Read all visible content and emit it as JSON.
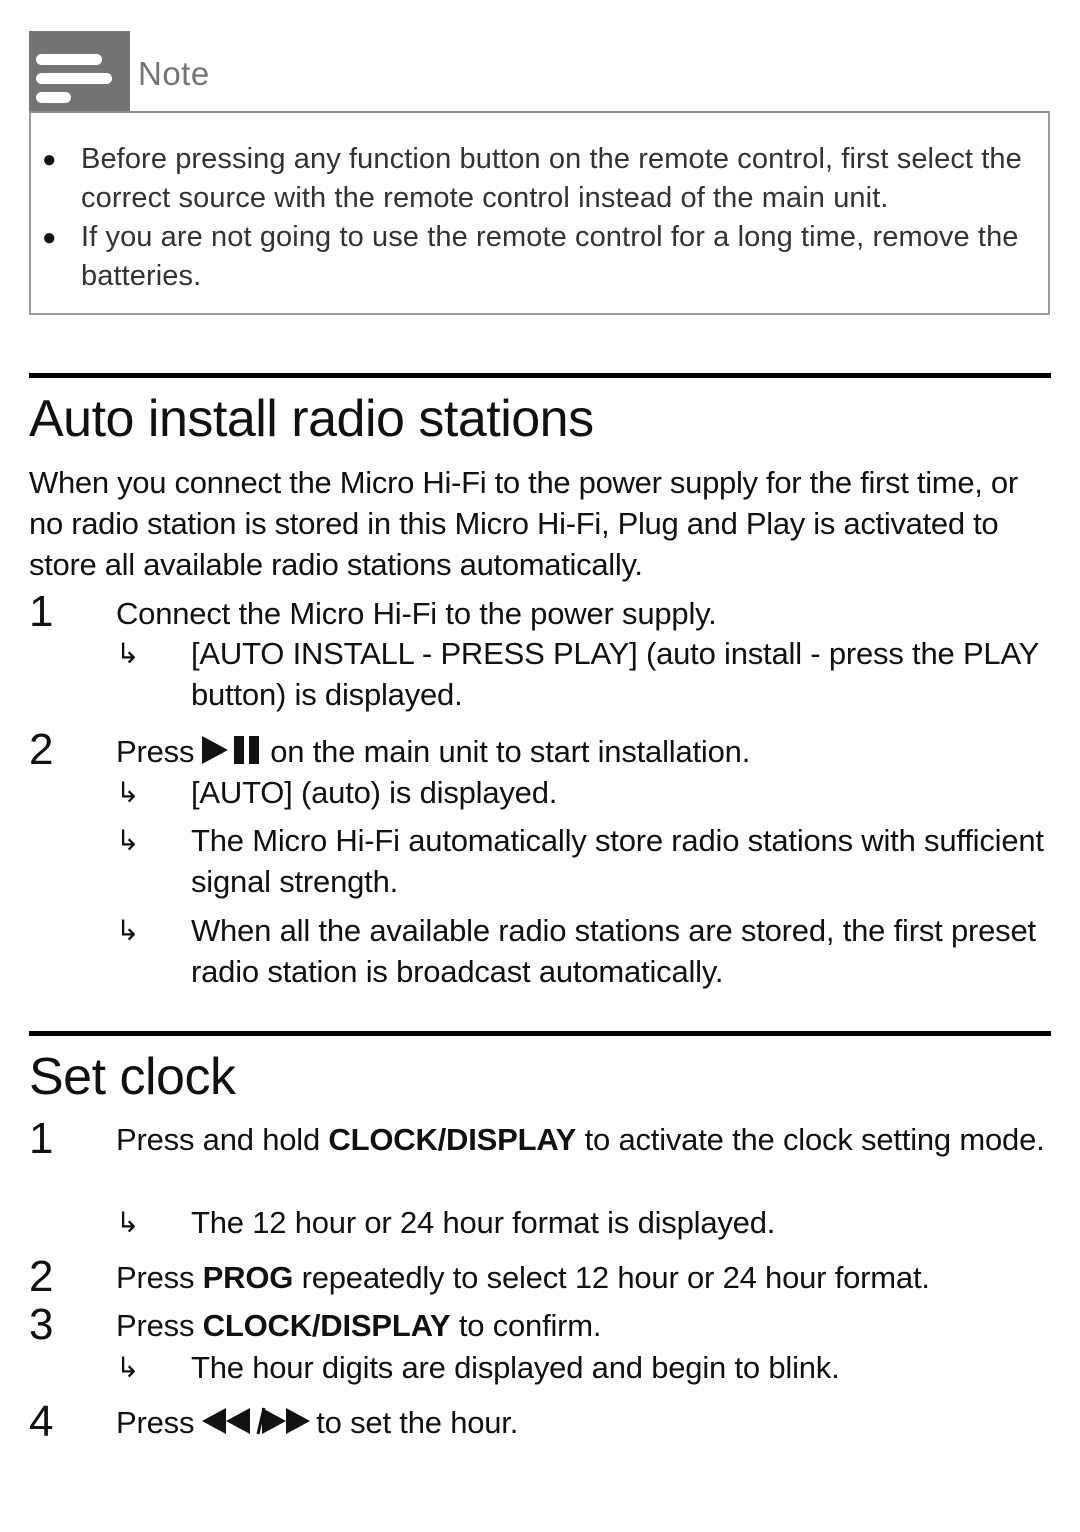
{
  "note": {
    "icon": "note-icon",
    "title": "Note",
    "items": [
      "Before pressing any function button on the remote control, first select the correct source with the remote control instead of the main unit.",
      "If you are not going to use the remote control for a long time, remove the batteries."
    ]
  },
  "auto_install": {
    "title": "Auto install radio stations",
    "intro": "When you connect the Micro Hi-Fi to the power supply for the first time, or no radio station is stored in this Micro Hi-Fi, Plug and Play is activated to store all available radio stations automatically.",
    "steps": [
      {
        "number": "1",
        "text": "Connect the Micro Hi-Fi to the power supply.",
        "results": [
          "[AUTO INSTALL - PRESS PLAY] (auto install - press the PLAY button) is displayed."
        ]
      },
      {
        "number": "2",
        "text_before": "Press",
        "icon": "play-pause-icon",
        "text_after": "on the main unit to start installation.",
        "results": [
          "[AUTO] (auto) is displayed.",
          "The Micro Hi-Fi automatically store radio stations with sufficient signal strength.",
          "When all the available radio stations are stored, the first preset radio station is broadcast automatically."
        ]
      }
    ]
  },
  "set_clock": {
    "title": "Set clock",
    "steps": [
      {
        "number": "1",
        "text_before": "Press and hold",
        "bold": "CLOCK/DISPLAY",
        "text_after": "to activate the clock setting mode.",
        "results": [
          "The 12 hour or 24 hour format is displayed."
        ]
      },
      {
        "number": "2",
        "text_before": "Press",
        "bold": "PROG",
        "text_after": "repeatedly to select 12 hour or 24 hour format."
      },
      {
        "number": "3",
        "text_before": "Press",
        "bold": "CLOCK/DISPLAY",
        "text_after": "to confirm.",
        "results": [
          "The hour digits are displayed and begin to blink."
        ]
      },
      {
        "number": "4",
        "text_before": "Press",
        "icon": "previous-next-icon",
        "icon_separator": "/",
        "text_after": "to set the hour."
      }
    ]
  },
  "result_arrow": "↳"
}
